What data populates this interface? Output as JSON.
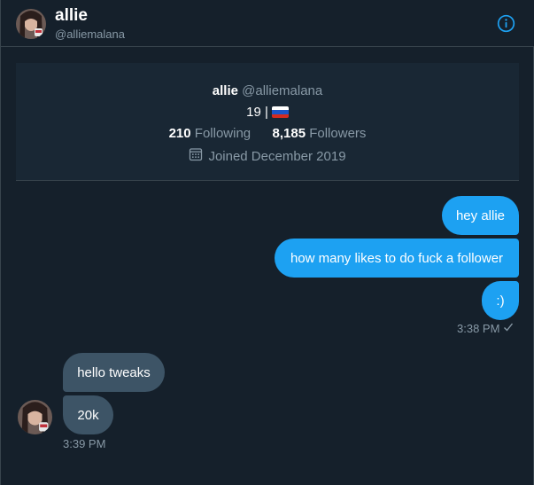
{
  "header": {
    "name": "allie",
    "handle": "@alliemalana",
    "info_icon": "info-icon"
  },
  "profile": {
    "name": "allie",
    "handle": "@alliemalana",
    "age": "19 |",
    "flag_icon": "russia-flag-icon",
    "following_count": "210",
    "following_label": "Following",
    "followers_count": "8,185",
    "followers_label": "Followers",
    "calendar_icon": "calendar-icon",
    "joined": "Joined December 2019"
  },
  "messages": {
    "outgoing": [
      "hey allie",
      "how many likes to do fuck a follower",
      ":)"
    ],
    "outgoing_time": "3:38 PM",
    "read_icon": "checkmark-icon",
    "incoming": [
      "hello tweaks",
      "20k"
    ],
    "incoming_time": "3:39 PM"
  },
  "colors": {
    "background": "#15202b",
    "card": "#192734",
    "accent": "#1da1f2",
    "incoming_bubble": "#3d5466",
    "secondary_text": "#8899a6",
    "border": "#38444d"
  }
}
